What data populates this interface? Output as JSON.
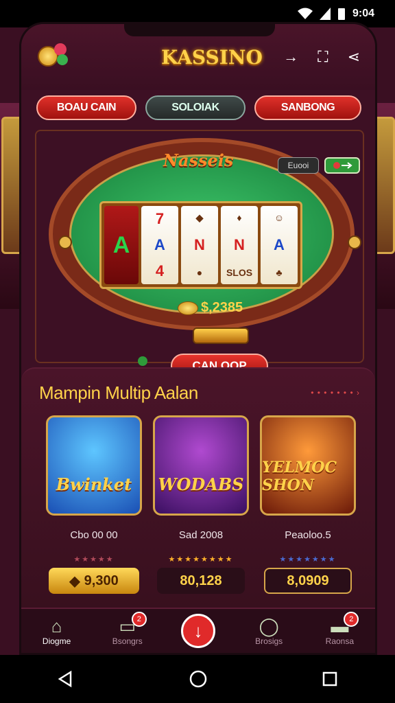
{
  "status_bar": {
    "time": "9:04"
  },
  "header": {
    "title": "KASSINO"
  },
  "tabs": [
    "BOAU CAIN",
    "SOLOIAK",
    "SANBONG"
  ],
  "table": {
    "title": "Nasseis",
    "pill_left": "Euooi",
    "reel_label": "SLOS",
    "coins": "$,2385",
    "cashout_label": "CAN OOP"
  },
  "games": {
    "title": "Mampin Multip Aalan",
    "see_more": "• • • • • • •",
    "items": [
      {
        "thumb_text": "Bwinket",
        "name": "Cbo 00 00",
        "stars": "★★★★★",
        "price": "9,300"
      },
      {
        "thumb_text": "WODABS",
        "name": "Sad 2008",
        "stars": "★★★★★★★★",
        "price": "80,128"
      },
      {
        "thumb_text": "YELMOC SHON",
        "name": "Peaoloo.5",
        "stars": "★★★★★★★",
        "price": "8,0909"
      }
    ]
  },
  "bottom_nav": [
    {
      "label": "Diogme",
      "icon": "home-icon"
    },
    {
      "label": "Bsongrs",
      "icon": "card-icon",
      "badge": "2"
    },
    {
      "label": "",
      "icon": "download-icon"
    },
    {
      "label": "Brosigs",
      "icon": "chat-icon"
    },
    {
      "label": "Raonsa",
      "icon": "gift-icon",
      "badge": "2"
    }
  ],
  "colors": {
    "accent": "#e02a2a",
    "gold": "#ffd24a",
    "felt": "#2faa56"
  }
}
